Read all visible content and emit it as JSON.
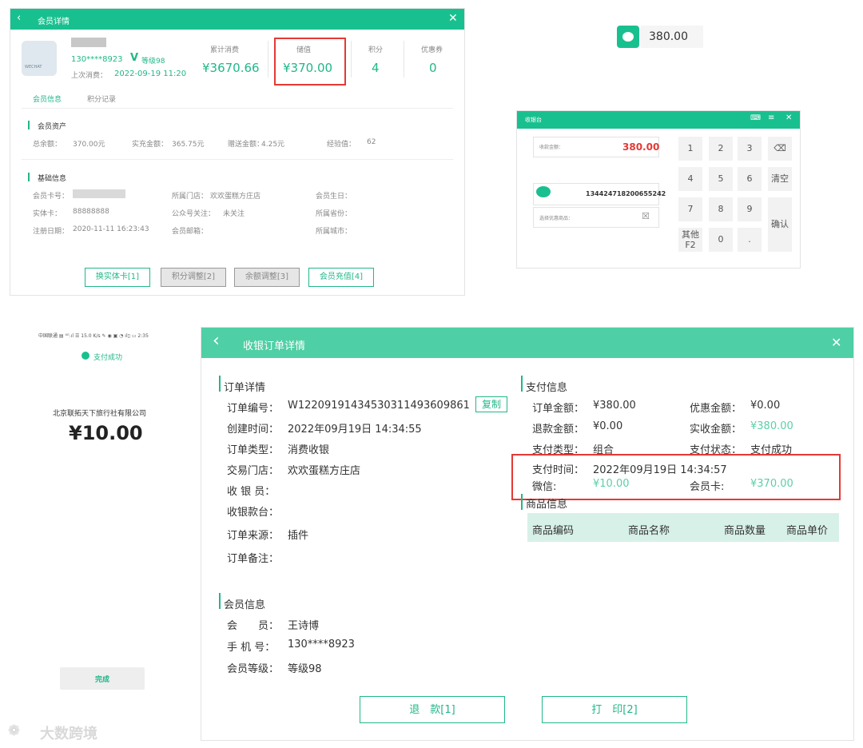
{
  "member_detail": {
    "title": "会员详情",
    "phone": "130****8923",
    "level": "等级98",
    "avatar_text": "WECHAT",
    "last_consume_label": "上次消费：",
    "last_consume_time": "2022-09-19 11:20",
    "stats": [
      {
        "label": "累计消费",
        "value": "¥3670.66"
      },
      {
        "label": "储值",
        "value": "¥370.00"
      },
      {
        "label": "积分",
        "value": "4"
      },
      {
        "label": "优惠券",
        "value": "0"
      }
    ],
    "tabs": [
      "会员信息",
      "积分记录"
    ],
    "assets_title": "会员资产",
    "assets": [
      {
        "label": "总余额：",
        "value": "370.00元"
      },
      {
        "label": "实充金额：",
        "value": "365.75元"
      },
      {
        "label": "赠送金额：",
        "value": "4.25元"
      },
      {
        "label": "经验值：",
        "value": "62"
      }
    ],
    "basic_title": "基础信息",
    "basic": {
      "card_no_label": "会员卡号：",
      "physical_card_label": "实体卡：",
      "physical_card_value": "88888888",
      "register_label": "注册日期：",
      "register_value": "2020-11-11 16:23:43",
      "store_label": "所属门店：",
      "store_value": "欢欢蛋糕方庄店",
      "wechat_label": "公众号关注：",
      "wechat_value": "未关注",
      "email_label": "会员邮箱：",
      "birthday_label": "会员生日：",
      "province_label": "所属省份：",
      "city_label": "所属城市："
    },
    "buttons": [
      "换实体卡[1]",
      "积分调整[2]",
      "余额调整[3]",
      "会员充值[4]"
    ]
  },
  "balance_badge": {
    "value": "380.00"
  },
  "cashier": {
    "title": "收银台",
    "amount_label": "收款金额：",
    "amount_value": "380.00",
    "auth_code": "134424718200655242",
    "coupon_placeholder": "选择优惠商品：",
    "keys": [
      "1",
      "2",
      "3",
      "4",
      "5",
      "6",
      "7",
      "8",
      "9",
      "0",
      "."
    ],
    "clear_label": "清空",
    "confirm_label": "确认",
    "other_label": "其他",
    "other_key": "F2"
  },
  "phone": {
    "status_bar": "中国联通 ▤ ⁴ᴳ.ıl ☰ 15.0 K/s ✎     ◉ ▣ ◔ ıl▯ ▭ 2:35",
    "success": "支付成功",
    "merchant": "北京联拓天下旅行社有限公司",
    "amount": "¥10.00",
    "done": "完成"
  },
  "order": {
    "title": "收银订单详情",
    "detail_title": "订单详情",
    "fields": [
      {
        "label": "订单编号：",
        "value": "W1220919143453031149360986​1"
      },
      {
        "label": "创建时间：",
        "value": "2022年09月19日 14:34:55"
      },
      {
        "label": "订单类型：",
        "value": "消费收银"
      },
      {
        "label": "交易门店：",
        "value": "欢欢蛋糕方庄店"
      },
      {
        "label": "收 银 员：",
        "value": ""
      },
      {
        "label": "收银款台：",
        "value": ""
      },
      {
        "label": "订单来源：",
        "value": "插件"
      },
      {
        "label": "订单备注：",
        "value": ""
      }
    ],
    "copy_label": "复制",
    "member_title": "会员信息",
    "member_fields": [
      {
        "label": "会　　员：",
        "value": "王诗博"
      },
      {
        "label": "手 机 号：",
        "value": "130****8923"
      },
      {
        "label": "会员等级：",
        "value": "等级98"
      }
    ],
    "pay_title": "支付信息",
    "pay": {
      "order_amount_label": "订单金额：",
      "order_amount": "¥380.00",
      "discount_label": "优惠金额：",
      "discount": "¥0.00",
      "refund_label": "退款金额：",
      "refund": "¥0.00",
      "received_label": "实收金额：",
      "received": "¥380.00",
      "pay_type_label": "支付类型：",
      "pay_type": "组合",
      "pay_status_label": "支付状态：",
      "pay_status": "支付成功",
      "pay_time_label": "支付时间：",
      "pay_time": "2022年09月19日 14:34:57",
      "wechat_label": "微信:",
      "wechat_value": "¥10.00",
      "card_label": "会员卡:",
      "card_value": "¥370.00"
    },
    "goods_title": "商品信息",
    "goods_columns": [
      "商品编码",
      "商品名称",
      "商品数量",
      "商品单价"
    ],
    "buttons": [
      "退　款[1]",
      "打　印[2]"
    ]
  },
  "watermark": "大数跨境",
  "colors": {
    "accent": "#19c08f",
    "highlight": "#e53935",
    "price_red": "#e53935"
  }
}
